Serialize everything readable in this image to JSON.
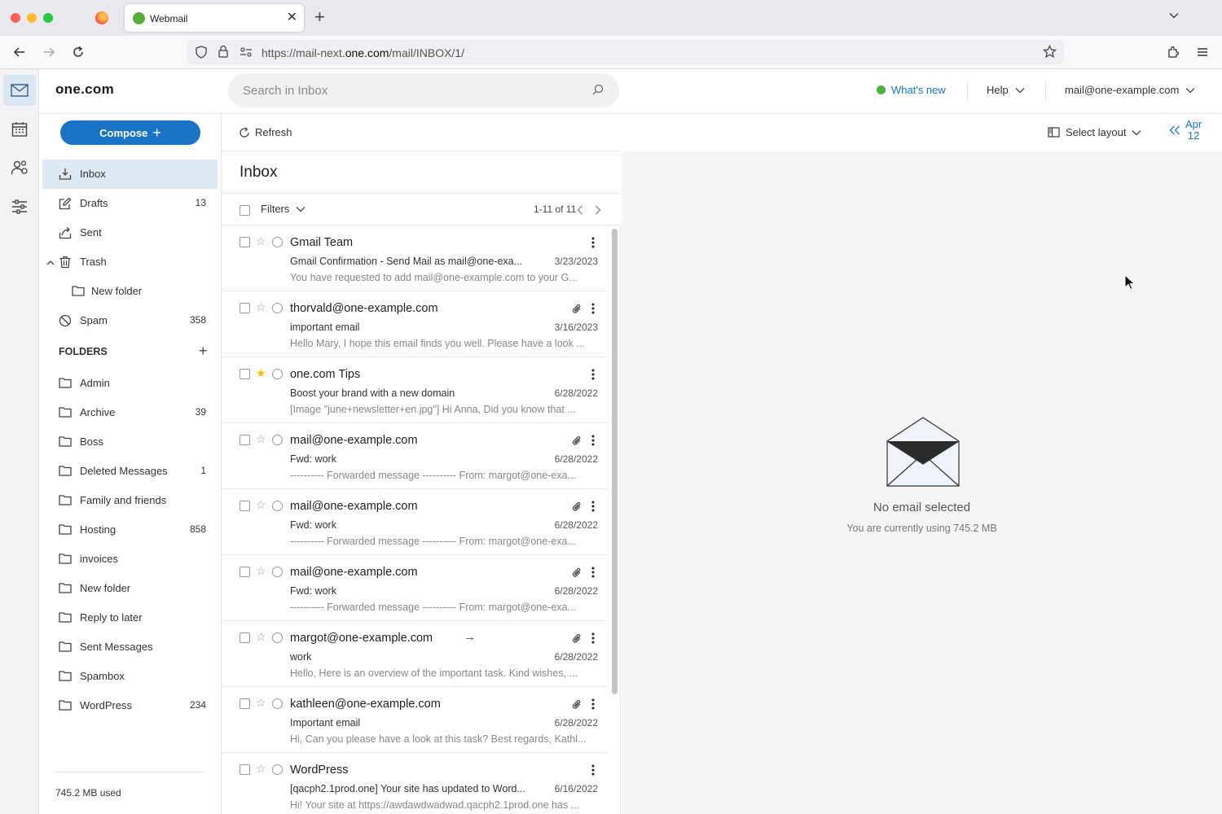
{
  "browser": {
    "tab_title": "Webmail",
    "url_prefix": "https://mail-next.",
    "url_domain": "one.com",
    "url_path": "/mail/INBOX/1/"
  },
  "app": {
    "logo": "one.com",
    "search_placeholder": "Search in Inbox",
    "whats_new": "What's new",
    "help": "Help",
    "account": "mail@one-example.com",
    "compose": "Compose",
    "refresh": "Refresh",
    "select_layout": "Select layout",
    "date_month": "Apr",
    "date_day": "12"
  },
  "sidebar": {
    "items": [
      {
        "label": "Inbox",
        "count": "",
        "icon": "inbox-icon"
      },
      {
        "label": "Drafts",
        "count": "13",
        "icon": "drafts-icon"
      },
      {
        "label": "Sent",
        "count": "",
        "icon": "sent-icon"
      },
      {
        "label": "Trash",
        "count": "",
        "icon": "trash-icon"
      },
      {
        "label": "New folder",
        "count": "",
        "icon": "folder-icon"
      },
      {
        "label": "Spam",
        "count": "358",
        "icon": "spam-icon"
      }
    ],
    "folders_heading": "FOLDERS",
    "folders": [
      {
        "label": "Admin",
        "count": ""
      },
      {
        "label": "Archive",
        "count": "39"
      },
      {
        "label": "Boss",
        "count": ""
      },
      {
        "label": "Deleted Messages",
        "count": "1"
      },
      {
        "label": "Family and friends",
        "count": ""
      },
      {
        "label": "Hosting",
        "count": "858"
      },
      {
        "label": "invoices",
        "count": ""
      },
      {
        "label": "New folder",
        "count": ""
      },
      {
        "label": "Reply to later",
        "count": ""
      },
      {
        "label": "Sent Messages",
        "count": ""
      },
      {
        "label": "Spambox",
        "count": ""
      },
      {
        "label": "WordPress",
        "count": "234"
      }
    ],
    "storage_used": "745.2 MB used"
  },
  "list": {
    "title": "Inbox",
    "filters": "Filters",
    "pager": "1-11 of 11",
    "messages": [
      {
        "from": "Gmail Team",
        "subject": "Gmail Confirmation - Send Mail as mail@one-exa...",
        "date": "3/23/2023",
        "preview": "You have requested to add mail@one-example.com to your G...",
        "starred": false,
        "attachment": false,
        "forwarded": false
      },
      {
        "from": "thorvald@one-example.com",
        "subject": "important email",
        "date": "3/16/2023",
        "preview": "Hello Mary, I hope this email finds you well. Please have a look ...",
        "starred": false,
        "attachment": true,
        "forwarded": false
      },
      {
        "from": "one.com Tips",
        "subject": "Boost your brand with a new domain",
        "date": "6/28/2022",
        "preview": "[Image \"june+newsletter+en.jpg\"] Hi Anna, Did you know that ...",
        "starred": true,
        "attachment": false,
        "forwarded": false
      },
      {
        "from": "mail@one-example.com",
        "subject": "Fwd: work",
        "date": "6/28/2022",
        "preview": "---------- Forwarded message ---------- From: margot@one-exa...",
        "starred": false,
        "attachment": true,
        "forwarded": false
      },
      {
        "from": "mail@one-example.com",
        "subject": "Fwd: work",
        "date": "6/28/2022",
        "preview": "---------- Forwarded message ---------- From: margot@one-exa...",
        "starred": false,
        "attachment": true,
        "forwarded": false
      },
      {
        "from": "mail@one-example.com",
        "subject": "Fwd: work",
        "date": "6/28/2022",
        "preview": "---------- Forwarded message ---------- From: margot@one-exa...",
        "starred": false,
        "attachment": true,
        "forwarded": false
      },
      {
        "from": "margot@one-example.com",
        "subject": "work",
        "date": "6/28/2022",
        "preview": "Hello, Here is an overview of the important task. Kind wishes, ...",
        "starred": false,
        "attachment": true,
        "forwarded": true
      },
      {
        "from": "kathleen@one-example.com",
        "subject": "Important email",
        "date": "6/28/2022",
        "preview": "Hi, Can you please have a look at this task? Best regards, Kathl...",
        "starred": false,
        "attachment": true,
        "forwarded": false
      },
      {
        "from": "WordPress",
        "subject": "[qacph2.1prod.one] Your site has updated to Word...",
        "date": "6/16/2022",
        "preview": "Hi! Your site at https://awdawdwadwad.qacph2.1prod.one has ...",
        "starred": false,
        "attachment": false,
        "forwarded": false
      }
    ]
  },
  "reading": {
    "empty_title": "No email selected",
    "empty_sub": "You are currently using 745.2 MB"
  },
  "colors": {
    "accent": "#1a73c5",
    "active_bg": "#dfe9f4",
    "star": "#f4c000",
    "online": "#4bb33e"
  }
}
